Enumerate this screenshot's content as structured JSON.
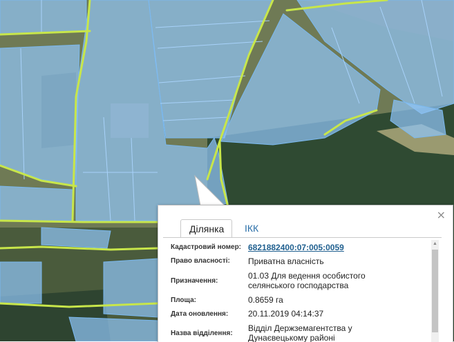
{
  "colors": {
    "parcel_fill": "#8fc3f5",
    "parcel_stroke": "#7ab8ef",
    "road": "#c8e64a",
    "forest": "#2c4a30",
    "field": "#7f8a5e",
    "link": "#1f5f8f"
  },
  "popup": {
    "close_label": "×",
    "tabs": [
      {
        "label": "Ділянка",
        "active": true
      },
      {
        "label": "ІКК",
        "active": false
      }
    ],
    "fields": [
      {
        "label": "Кадастровий номер:",
        "value": "6821882400:07:005:0059",
        "link": true
      },
      {
        "label": "Право власності:",
        "value": "Приватна власність"
      },
      {
        "label": "Призначення:",
        "value": "01.03 Для ведення особистого селянського господарства"
      },
      {
        "label": "Площа:",
        "value": "0.8659 га"
      },
      {
        "label": "Дата оновлення:",
        "value": "20.11.2019 04:14:37"
      },
      {
        "label": "Назва відділення:",
        "value": "Відділ Держземагентства у Дунаєвецькому районі"
      }
    ]
  }
}
